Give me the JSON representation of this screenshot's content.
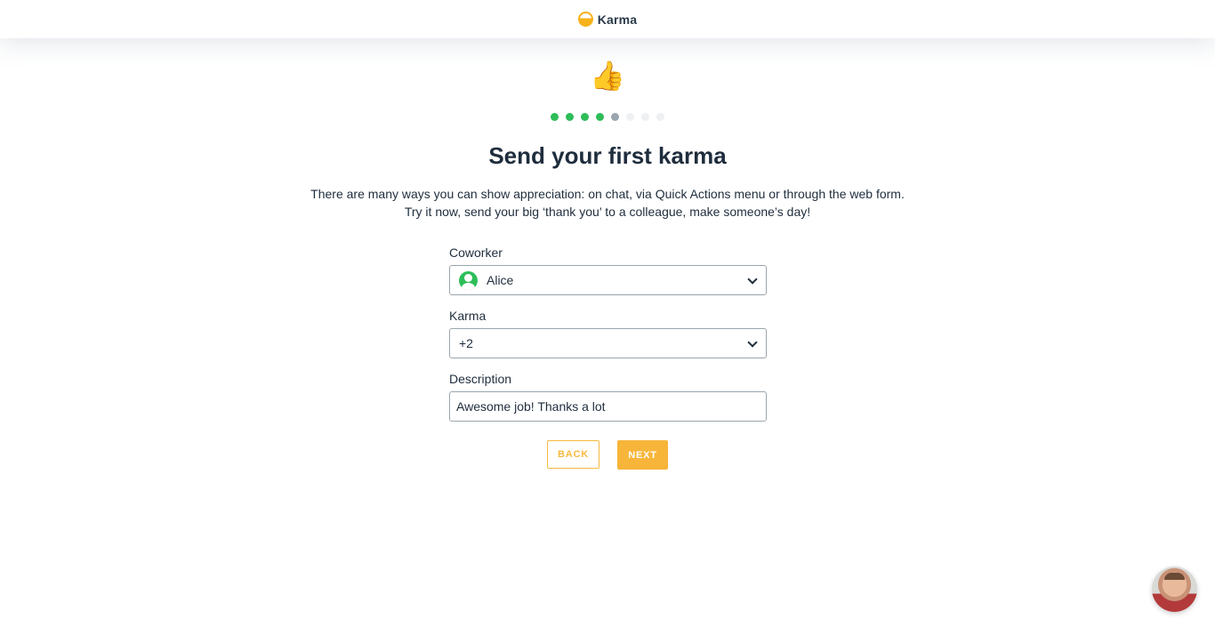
{
  "header": {
    "brand_name": "Karma",
    "icon": "karma-logo-icon"
  },
  "hero": {
    "icon": "thumbs-up-icon",
    "emoji": "👍"
  },
  "progress": {
    "total_steps": 8,
    "completed_steps": 4,
    "current_step": 5
  },
  "title": "Send your first karma",
  "description": {
    "line1": "There are many ways you can show appreciation: on chat, via Quick Actions menu or through the web form.",
    "line2": "Try it now, send your big ‘thank you’ to a colleague, make someone’s day!"
  },
  "form": {
    "coworker": {
      "label": "Coworker",
      "value": "Alice",
      "icon": "user-avatar-icon"
    },
    "karma": {
      "label": "Karma",
      "value": "+2"
    },
    "description": {
      "label": "Description",
      "value": "Awesome job! Thanks a lot"
    }
  },
  "buttons": {
    "back_label": "BACK",
    "next_label": "NEXT"
  },
  "colors": {
    "accent": "#f7b53a",
    "done_step": "#2ebd59",
    "current_step": "#9aa5ae",
    "todo_step": "#eef0f2"
  },
  "chat_widget": {
    "icon": "support-agent-avatar"
  }
}
